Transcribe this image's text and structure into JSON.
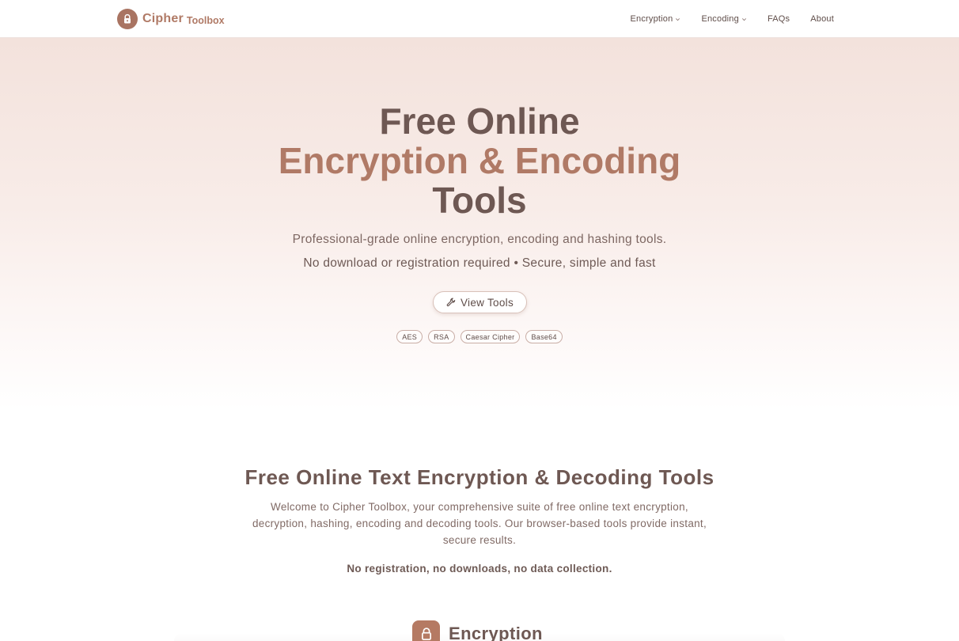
{
  "nav": {
    "logo_name": "Cipher",
    "logo_sub": "Toolbox",
    "links": [
      {
        "label": "Encryption",
        "dropdown": true
      },
      {
        "label": "Encoding",
        "dropdown": true
      },
      {
        "label": "FAQs",
        "dropdown": false
      },
      {
        "label": "About",
        "dropdown": false
      }
    ]
  },
  "hero": {
    "title_line1": "Free Online",
    "title_line2": "Encryption & Encoding",
    "title_line3": "Tools",
    "subtitle1": "Professional-grade online encryption, encoding and hashing tools.",
    "subtitle2": "No download or registration required • Secure, simple and fast",
    "button_label": "View Tools",
    "tags": [
      "AES",
      "RSA",
      "Caesar Cipher",
      "Base64"
    ]
  },
  "intro": {
    "title": "Free Online Text Encryption & Decoding Tools",
    "text": "Welcome to Cipher Toolbox, your comprehensive suite of free online text encryption, decryption, hashing, encoding and decoding tools. Our browser-based tools provide instant, secure results.",
    "note": "No registration, no downloads, no data collection."
  },
  "section": {
    "title": "Encryption"
  },
  "colors": {
    "accent": "#b07a66",
    "heading": "#6e5853",
    "hero_top": "#f3e2dc"
  },
  "icons": {
    "logo": "lock-icon",
    "button": "wrench-icon",
    "section": "lock-icon"
  }
}
